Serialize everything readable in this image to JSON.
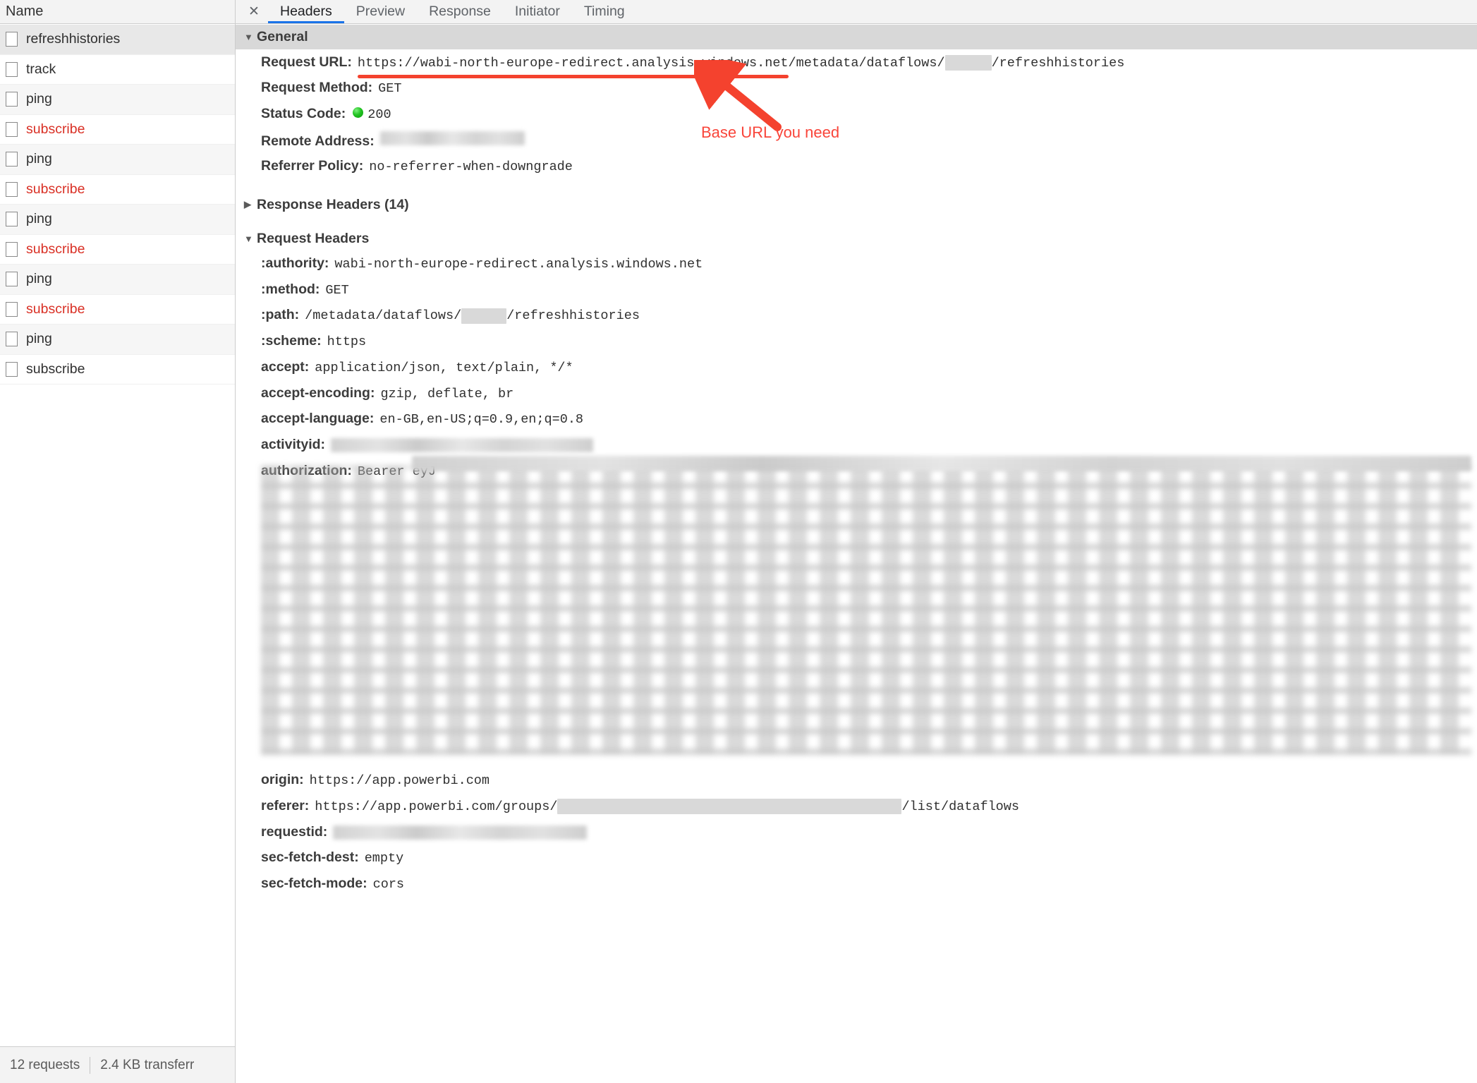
{
  "left_panel": {
    "column_header": "Name",
    "rows": [
      {
        "label": "refreshhistories",
        "style": "selected",
        "color": "normal"
      },
      {
        "label": "track",
        "style": "plain",
        "color": "normal"
      },
      {
        "label": "ping",
        "style": "alt",
        "color": "normal"
      },
      {
        "label": "subscribe",
        "style": "plain",
        "color": "red"
      },
      {
        "label": "ping",
        "style": "alt",
        "color": "normal"
      },
      {
        "label": "subscribe",
        "style": "plain",
        "color": "red"
      },
      {
        "label": "ping",
        "style": "alt",
        "color": "normal"
      },
      {
        "label": "subscribe",
        "style": "plain",
        "color": "red"
      },
      {
        "label": "ping",
        "style": "alt",
        "color": "normal"
      },
      {
        "label": "subscribe",
        "style": "plain",
        "color": "red"
      },
      {
        "label": "ping",
        "style": "alt",
        "color": "normal"
      },
      {
        "label": "subscribe",
        "style": "plain",
        "color": "normal"
      }
    ],
    "status_bar": {
      "requests": "12 requests",
      "transferred": "2.4 KB transferr"
    }
  },
  "tabs": {
    "close_label": "✕",
    "items": [
      {
        "label": "Headers",
        "active": true
      },
      {
        "label": "Preview",
        "active": false
      },
      {
        "label": "Response",
        "active": false
      },
      {
        "label": "Initiator",
        "active": false
      },
      {
        "label": "Timing",
        "active": false
      }
    ]
  },
  "general": {
    "title": "General",
    "expanded": true,
    "request_url_label": "Request URL:",
    "request_url_prefix": "https://wabi-north-europe-redirect.analysis.windows.net",
    "request_url_mid": "/metadata/dataflows/",
    "request_url_suffix": "/refreshhistories",
    "request_method_label": "Request Method:",
    "request_method_value": "GET",
    "status_code_label": "Status Code:",
    "status_code_value": "200",
    "status_code_color": "#22c322",
    "remote_address_label": "Remote Address:",
    "remote_address_value": "",
    "referrer_policy_label": "Referrer Policy:",
    "referrer_policy_value": "no-referrer-when-downgrade"
  },
  "response_headers": {
    "title": "Response Headers (14)",
    "expanded": false
  },
  "request_headers": {
    "title": "Request Headers",
    "expanded": true,
    "items": [
      {
        "key": ":authority:",
        "value": "wabi-north-europe-redirect.analysis.windows.net"
      },
      {
        "key": ":method:",
        "value": "GET"
      },
      {
        "key": ":path:",
        "value": "/metadata/dataflows/",
        "value_after": "/refreshhistories",
        "redacted_mid": true
      },
      {
        "key": ":scheme:",
        "value": "https"
      },
      {
        "key": "accept:",
        "value": "application/json, text/plain, */*"
      },
      {
        "key": "accept-encoding:",
        "value": "gzip, deflate, br"
      },
      {
        "key": "accept-language:",
        "value": "en-GB,en-US;q=0.9,en;q=0.8"
      },
      {
        "key": "activityid:",
        "value": "",
        "blurred": true
      },
      {
        "key": "authorization:",
        "value": "Bearer eyJ",
        "blurred_tail": true
      },
      {
        "key": "origin:",
        "value": "https://app.powerbi.com"
      },
      {
        "key": "referer:",
        "value": "https://app.powerbi.com/groups/",
        "value_after": "/list/dataflows",
        "redacted_mid": true
      },
      {
        "key": "requestid:",
        "value": "",
        "blurred": true
      },
      {
        "key": "sec-fetch-dest:",
        "value": "empty"
      },
      {
        "key": "sec-fetch-mode:",
        "value": "cors"
      }
    ]
  },
  "annotation": {
    "text": "Base URL you need",
    "color": "#f9453a",
    "arrow_name": "arrow-pointing-to-request-url"
  }
}
